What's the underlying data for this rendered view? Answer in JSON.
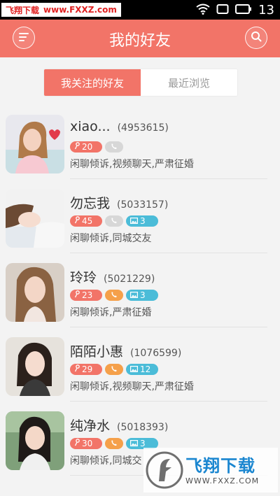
{
  "status_bar": {
    "watermark_left": "飞翔下载",
    "watermark_domain": "www.FXXZ.com",
    "time": "13"
  },
  "header": {
    "title": "我的好友",
    "menu_icon": "menu-icon",
    "search_icon": "search-icon"
  },
  "tabs": [
    {
      "label": "我关注的好友",
      "active": true
    },
    {
      "label": "最近浏览",
      "active": false
    }
  ],
  "friends": [
    {
      "name": "xiao...",
      "id": "(4953615)",
      "count": "20",
      "phone": false,
      "photos": null,
      "tags": "闲聊倾诉,视频聊天,严肃征婚"
    },
    {
      "name": "勿忘我",
      "id": "(5033157)",
      "count": "45",
      "phone": false,
      "photos": "3",
      "tags": "闲聊倾诉,同城交友"
    },
    {
      "name": "玲玲",
      "id": "(5021229)",
      "count": "23",
      "phone": true,
      "photos": "3",
      "tags": "闲聊倾诉,严肃征婚"
    },
    {
      "name": "陌陌小惠",
      "id": "(1076599)",
      "count": "29",
      "phone": true,
      "photos": "12",
      "tags": "闲聊倾诉,视频聊天,严肃征婚"
    },
    {
      "name": "纯净水",
      "id": "(5018393)",
      "count": "30",
      "phone": true,
      "photos": "3",
      "tags": "闲聊倾诉,同城交"
    }
  ],
  "colors": {
    "accent": "#f27468",
    "phone_active": "#f5a04a",
    "phone_inactive": "#d7d7d7",
    "photo_badge": "#4bbcd8"
  },
  "watermark_bottom": {
    "brand": "飞翔下载",
    "domain": "WWW.FXXZ.COM"
  }
}
